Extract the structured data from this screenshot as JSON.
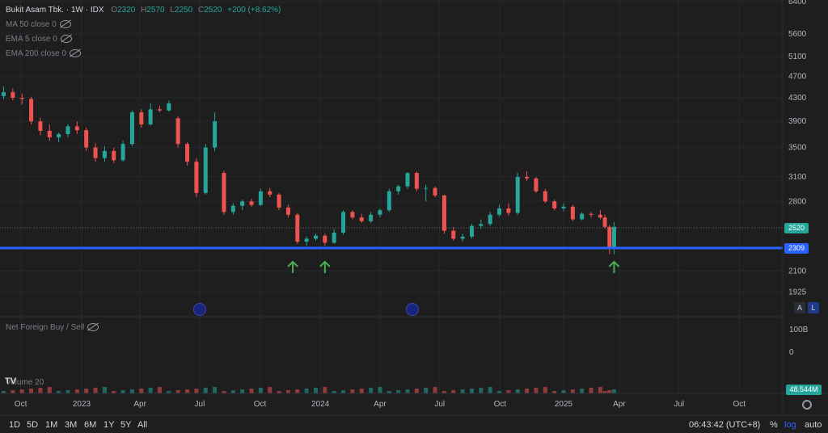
{
  "header": {
    "symbol": "Bukit Asam Tbk. · 1W · IDX",
    "open_label": "O",
    "open_value": "2320",
    "high_label": "H",
    "high_value": "2570",
    "low_label": "L",
    "low_value": "2250",
    "close_label": "C",
    "close_value": "2520",
    "change": "+200 (+8.62%)"
  },
  "indicators": [
    {
      "label": "MA 50 close 0"
    },
    {
      "label": "EMA 5 close 0"
    },
    {
      "label": "EMA 200 close 0"
    }
  ],
  "lower_pane": {
    "foreign_label": "Net Foreign Buy / Sell",
    "volume_label": "Volume 20",
    "axis_100b": "100B",
    "axis_0": "0",
    "volume_tag": "48.544M"
  },
  "price_tags": {
    "current": "2520",
    "line": "2309"
  },
  "scale_buttons": {
    "auto_scale": "A",
    "log_scale": "L"
  },
  "bottom": {
    "ranges": [
      "1D",
      "5D",
      "1M",
      "3M",
      "6M",
      "1Y",
      "5Y",
      "All"
    ],
    "time": "06:43:42 (UTC+8)",
    "percent": "%",
    "log": "log",
    "auto": "auto"
  },
  "colors": {
    "up": "#26a69a",
    "down": "#ef5350",
    "line": "#2962ff",
    "arrow": "#4caf50"
  },
  "chart_data": {
    "type": "candlestick",
    "title": "Bukit Asam Tbk. · 1W · IDX",
    "y_scale": "log",
    "y_ticks": [
      "6400",
      "5600",
      "5100",
      "4700",
      "4300",
      "3900",
      "3500",
      "3100",
      "2800",
      "2520",
      "2309",
      "2100",
      "1925"
    ],
    "x_ticks": [
      "Oct",
      "2023",
      "Apr",
      "Jul",
      "Oct",
      "2024",
      "Apr",
      "Jul",
      "Oct",
      "2025",
      "Apr",
      "Jul",
      "Oct"
    ],
    "horizontal_line": 2309,
    "last_close": 2520,
    "candles": [
      {
        "t": "2022-09-05",
        "o": 4330,
        "h": 4510,
        "l": 4280,
        "c": 4400
      },
      {
        "t": "2022-09-19",
        "o": 4400,
        "h": 4470,
        "l": 4250,
        "c": 4300
      },
      {
        "t": "2022-10-03",
        "o": 4300,
        "h": 4380,
        "l": 4180,
        "c": 4280
      },
      {
        "t": "2022-10-17",
        "o": 4280,
        "h": 4320,
        "l": 3850,
        "c": 3900
      },
      {
        "t": "2022-10-31",
        "o": 3900,
        "h": 3960,
        "l": 3680,
        "c": 3750
      },
      {
        "t": "2022-11-14",
        "o": 3750,
        "h": 3850,
        "l": 3600,
        "c": 3650
      },
      {
        "t": "2022-11-28",
        "o": 3650,
        "h": 3720,
        "l": 3580,
        "c": 3700
      },
      {
        "t": "2022-12-12",
        "o": 3700,
        "h": 3860,
        "l": 3650,
        "c": 3820
      },
      {
        "t": "2022-12-26",
        "o": 3820,
        "h": 3900,
        "l": 3700,
        "c": 3760
      },
      {
        "t": "2023-01-09",
        "o": 3760,
        "h": 3800,
        "l": 3450,
        "c": 3500
      },
      {
        "t": "2023-01-23",
        "o": 3500,
        "h": 3560,
        "l": 3300,
        "c": 3350
      },
      {
        "t": "2023-02-06",
        "o": 3350,
        "h": 3520,
        "l": 3300,
        "c": 3450
      },
      {
        "t": "2023-02-20",
        "o": 3450,
        "h": 3500,
        "l": 3280,
        "c": 3320
      },
      {
        "t": "2023-03-06",
        "o": 3320,
        "h": 3600,
        "l": 3300,
        "c": 3550
      },
      {
        "t": "2023-03-20",
        "o": 3550,
        "h": 4080,
        "l": 3520,
        "c": 4050
      },
      {
        "t": "2023-04-03",
        "o": 4050,
        "h": 4100,
        "l": 3800,
        "c": 3850
      },
      {
        "t": "2023-04-17",
        "o": 3850,
        "h": 4200,
        "l": 3830,
        "c": 4100
      },
      {
        "t": "2023-05-01",
        "o": 4100,
        "h": 4160,
        "l": 4050,
        "c": 4080
      },
      {
        "t": "2023-05-15",
        "o": 4080,
        "h": 4250,
        "l": 4060,
        "c": 4200
      },
      {
        "t": "2023-05-29",
        "o": 3950,
        "h": 3980,
        "l": 3500,
        "c": 3550
      },
      {
        "t": "2023-06-12",
        "o": 3550,
        "h": 3580,
        "l": 3250,
        "c": 3300
      },
      {
        "t": "2023-06-26",
        "o": 3300,
        "h": 3350,
        "l": 2850,
        "c": 2900
      },
      {
        "t": "2023-07-10",
        "o": 2900,
        "h": 3550,
        "l": 2880,
        "c": 3500
      },
      {
        "t": "2023-07-24",
        "o": 3500,
        "h": 4050,
        "l": 3450,
        "c": 3900
      },
      {
        "t": "2023-08-07",
        "o": 3150,
        "h": 3180,
        "l": 2650,
        "c": 2680
      },
      {
        "t": "2023-08-21",
        "o": 2680,
        "h": 2780,
        "l": 2650,
        "c": 2750
      },
      {
        "t": "2023-09-04",
        "o": 2750,
        "h": 2820,
        "l": 2700,
        "c": 2800
      },
      {
        "t": "2023-09-18",
        "o": 2800,
        "h": 2830,
        "l": 2740,
        "c": 2760
      },
      {
        "t": "2023-10-02",
        "o": 2760,
        "h": 2950,
        "l": 2750,
        "c": 2920
      },
      {
        "t": "2023-10-16",
        "o": 2920,
        "h": 2960,
        "l": 2850,
        "c": 2880
      },
      {
        "t": "2023-10-30",
        "o": 2880,
        "h": 2900,
        "l": 2700,
        "c": 2730
      },
      {
        "t": "2023-11-13",
        "o": 2730,
        "h": 2760,
        "l": 2620,
        "c": 2650
      },
      {
        "t": "2023-11-27",
        "o": 2650,
        "h": 2670,
        "l": 2350,
        "c": 2370
      },
      {
        "t": "2023-12-11",
        "o": 2370,
        "h": 2420,
        "l": 2330,
        "c": 2400
      },
      {
        "t": "2023-12-25",
        "o": 2400,
        "h": 2450,
        "l": 2380,
        "c": 2430
      },
      {
        "t": "2024-01-08",
        "o": 2430,
        "h": 2450,
        "l": 2330,
        "c": 2360
      },
      {
        "t": "2024-01-22",
        "o": 2360,
        "h": 2500,
        "l": 2350,
        "c": 2460
      },
      {
        "t": "2024-02-05",
        "o": 2460,
        "h": 2700,
        "l": 2440,
        "c": 2680
      },
      {
        "t": "2024-02-19",
        "o": 2680,
        "h": 2700,
        "l": 2600,
        "c": 2620
      },
      {
        "t": "2024-03-04",
        "o": 2620,
        "h": 2660,
        "l": 2560,
        "c": 2580
      },
      {
        "t": "2024-03-18",
        "o": 2580,
        "h": 2680,
        "l": 2560,
        "c": 2650
      },
      {
        "t": "2024-04-01",
        "o": 2650,
        "h": 2720,
        "l": 2620,
        "c": 2700
      },
      {
        "t": "2024-04-15",
        "o": 2700,
        "h": 2950,
        "l": 2680,
        "c": 2920
      },
      {
        "t": "2024-04-29",
        "o": 2920,
        "h": 3000,
        "l": 2880,
        "c": 2980
      },
      {
        "t": "2024-05-13",
        "o": 2980,
        "h": 3160,
        "l": 2950,
        "c": 3150
      },
      {
        "t": "2024-05-27",
        "o": 3150,
        "h": 3170,
        "l": 2920,
        "c": 2950
      },
      {
        "t": "2024-06-10",
        "o": 2950,
        "h": 3000,
        "l": 2800,
        "c": 2960
      },
      {
        "t": "2024-06-24",
        "o": 2960,
        "h": 2980,
        "l": 2850,
        "c": 2870
      },
      {
        "t": "2024-07-08",
        "o": 2870,
        "h": 2880,
        "l": 2450,
        "c": 2480
      },
      {
        "t": "2024-07-22",
        "o": 2480,
        "h": 2520,
        "l": 2380,
        "c": 2400
      },
      {
        "t": "2024-08-05",
        "o": 2400,
        "h": 2450,
        "l": 2370,
        "c": 2420
      },
      {
        "t": "2024-08-19",
        "o": 2420,
        "h": 2550,
        "l": 2400,
        "c": 2530
      },
      {
        "t": "2024-09-02",
        "o": 2530,
        "h": 2600,
        "l": 2500,
        "c": 2550
      },
      {
        "t": "2024-09-16",
        "o": 2550,
        "h": 2680,
        "l": 2530,
        "c": 2650
      },
      {
        "t": "2024-09-30",
        "o": 2650,
        "h": 2760,
        "l": 2630,
        "c": 2720
      },
      {
        "t": "2024-10-14",
        "o": 2720,
        "h": 2780,
        "l": 2640,
        "c": 2670
      },
      {
        "t": "2024-10-28",
        "o": 2670,
        "h": 3150,
        "l": 2650,
        "c": 3100
      },
      {
        "t": "2024-11-11",
        "o": 3100,
        "h": 3170,
        "l": 3050,
        "c": 3080
      },
      {
        "t": "2024-11-25",
        "o": 3080,
        "h": 3100,
        "l": 2900,
        "c": 2920
      },
      {
        "t": "2024-12-09",
        "o": 2920,
        "h": 2950,
        "l": 2780,
        "c": 2800
      },
      {
        "t": "2024-12-23",
        "o": 2800,
        "h": 2820,
        "l": 2700,
        "c": 2720
      },
      {
        "t": "2025-01-06",
        "o": 2720,
        "h": 2780,
        "l": 2690,
        "c": 2740
      },
      {
        "t": "2025-01-20",
        "o": 2740,
        "h": 2760,
        "l": 2580,
        "c": 2600
      },
      {
        "t": "2025-02-03",
        "o": 2600,
        "h": 2680,
        "l": 2590,
        "c": 2660
      },
      {
        "t": "2025-02-17",
        "o": 2660,
        "h": 2680,
        "l": 2620,
        "c": 2650
      },
      {
        "t": "2025-03-03",
        "o": 2650,
        "h": 2700,
        "l": 2600,
        "c": 2620
      },
      {
        "t": "2025-03-10",
        "o": 2620,
        "h": 2650,
        "l": 2500,
        "c": 2520
      },
      {
        "t": "2025-03-17",
        "o": 2520,
        "h": 2540,
        "l": 2250,
        "c": 2320
      },
      {
        "t": "2025-03-24",
        "o": 2320,
        "h": 2570,
        "l": 2250,
        "c": 2520
      }
    ]
  }
}
